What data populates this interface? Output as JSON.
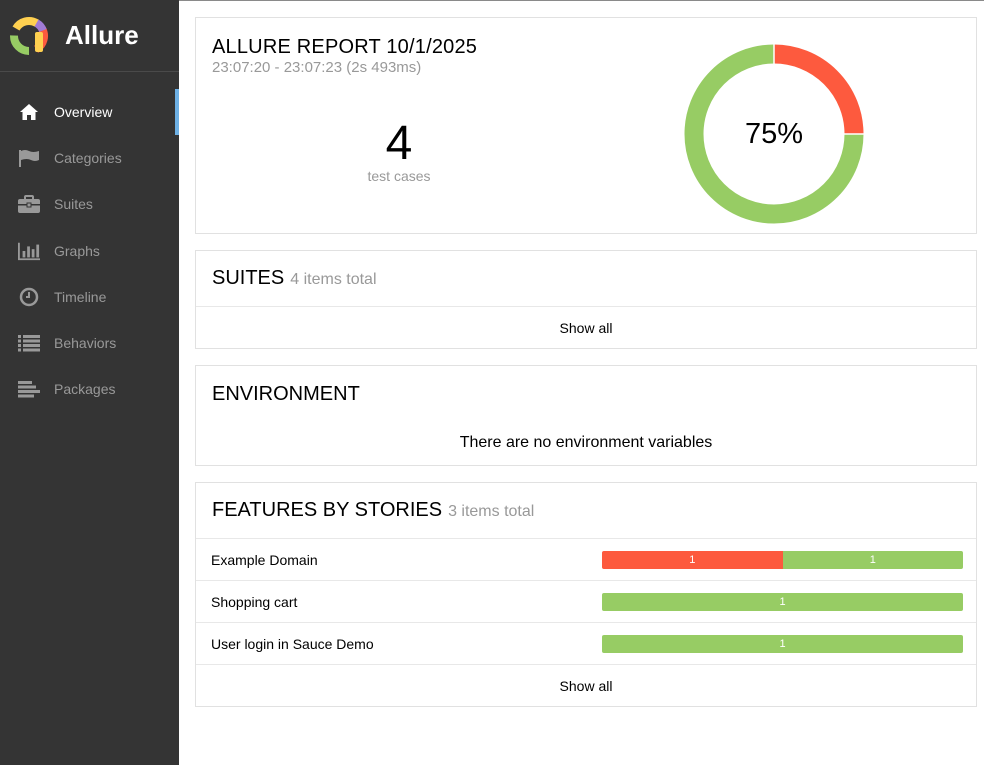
{
  "app": {
    "name": "Allure"
  },
  "sidebar": {
    "items": [
      {
        "label": "Overview",
        "icon": "home-icon",
        "active": true
      },
      {
        "label": "Categories",
        "icon": "flag-icon",
        "active": false
      },
      {
        "label": "Suites",
        "icon": "briefcase-icon",
        "active": false
      },
      {
        "label": "Graphs",
        "icon": "bar-chart-icon",
        "active": false
      },
      {
        "label": "Timeline",
        "icon": "clock-icon",
        "active": false
      },
      {
        "label": "Behaviors",
        "icon": "list-icon",
        "active": false
      },
      {
        "label": "Packages",
        "icon": "align-left-icon",
        "active": false
      }
    ]
  },
  "summary": {
    "title": "ALLURE REPORT 10/1/2025",
    "time": "23:07:20 - 23:07:23 (2s 493ms)",
    "count": "4",
    "count_label": "test cases",
    "percent": "75%",
    "passed_fraction": 0.75,
    "failed_fraction": 0.25
  },
  "suites": {
    "title": "SUITES",
    "count": "4 items total",
    "show_all": "Show all"
  },
  "environment": {
    "title": "ENVIRONMENT",
    "empty": "There are no environment variables"
  },
  "features": {
    "title": "FEATURES BY STORIES",
    "count": "3 items total",
    "show_all": "Show all",
    "rows": [
      {
        "name": "Example Domain",
        "failed": "1",
        "passed": "1"
      },
      {
        "name": "Shopping cart",
        "passed": "1"
      },
      {
        "name": "User login in Sauce Demo",
        "passed": "1"
      }
    ]
  },
  "colors": {
    "passed": "#97cc64",
    "failed": "#fd5a3e",
    "sidebar_bg": "#343434",
    "active_marker": "#6eb1e5"
  }
}
